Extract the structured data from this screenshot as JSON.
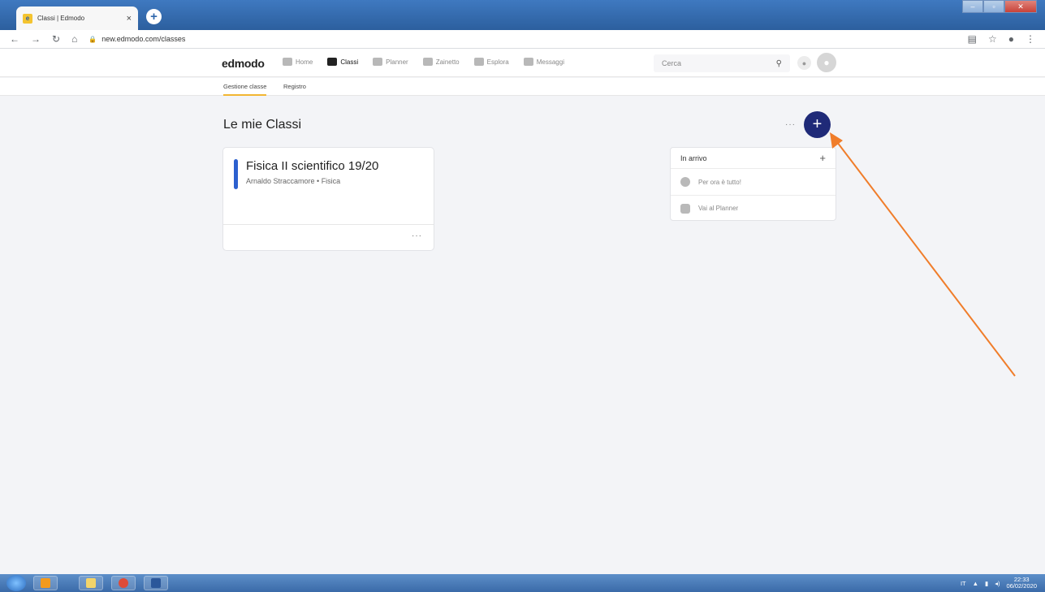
{
  "browser": {
    "tab_title": "Classi | Edmodo",
    "tab_close": "×",
    "new_tab": "+",
    "url": "new.edmodo.com/classes",
    "colors": {
      "tabbar": "#3f79c0"
    }
  },
  "header": {
    "logo": "edmodo",
    "nav": [
      {
        "label": "Home",
        "icon": "home-icon"
      },
      {
        "label": "Classi",
        "icon": "classes-icon",
        "active": true
      },
      {
        "label": "Planner",
        "icon": "planner-icon"
      },
      {
        "label": "Zainetto",
        "icon": "backpack-icon"
      },
      {
        "label": "Esplora",
        "icon": "rocket-icon"
      },
      {
        "label": "Messaggi",
        "icon": "messages-icon"
      }
    ],
    "search_placeholder": "Cerca"
  },
  "subnav": {
    "tabs": [
      {
        "label": "Gestione classe",
        "active": true
      },
      {
        "label": "Registro"
      }
    ]
  },
  "main": {
    "title": "Le mie Classi",
    "more": "···",
    "add_button": "+",
    "class_card": {
      "name": "Fisica II scientifico 19/20",
      "meta": "Arnaldo Straccamore • Fisica",
      "more": "···",
      "accent": "#2c60cf"
    }
  },
  "incoming": {
    "title": "In arrivo",
    "add": "+",
    "rows": [
      {
        "label": "Per ora è tutto!",
        "icon": "smile-icon"
      },
      {
        "label": "Vai al Planner",
        "icon": "calendar-icon"
      }
    ]
  },
  "taskbar": {
    "lang": "IT",
    "time": "22:33",
    "date": "06/02/2020"
  },
  "accent": {
    "fab": "#1f2a78",
    "arrow": "#f07d2a",
    "subtab_underline": "#f2b632"
  }
}
